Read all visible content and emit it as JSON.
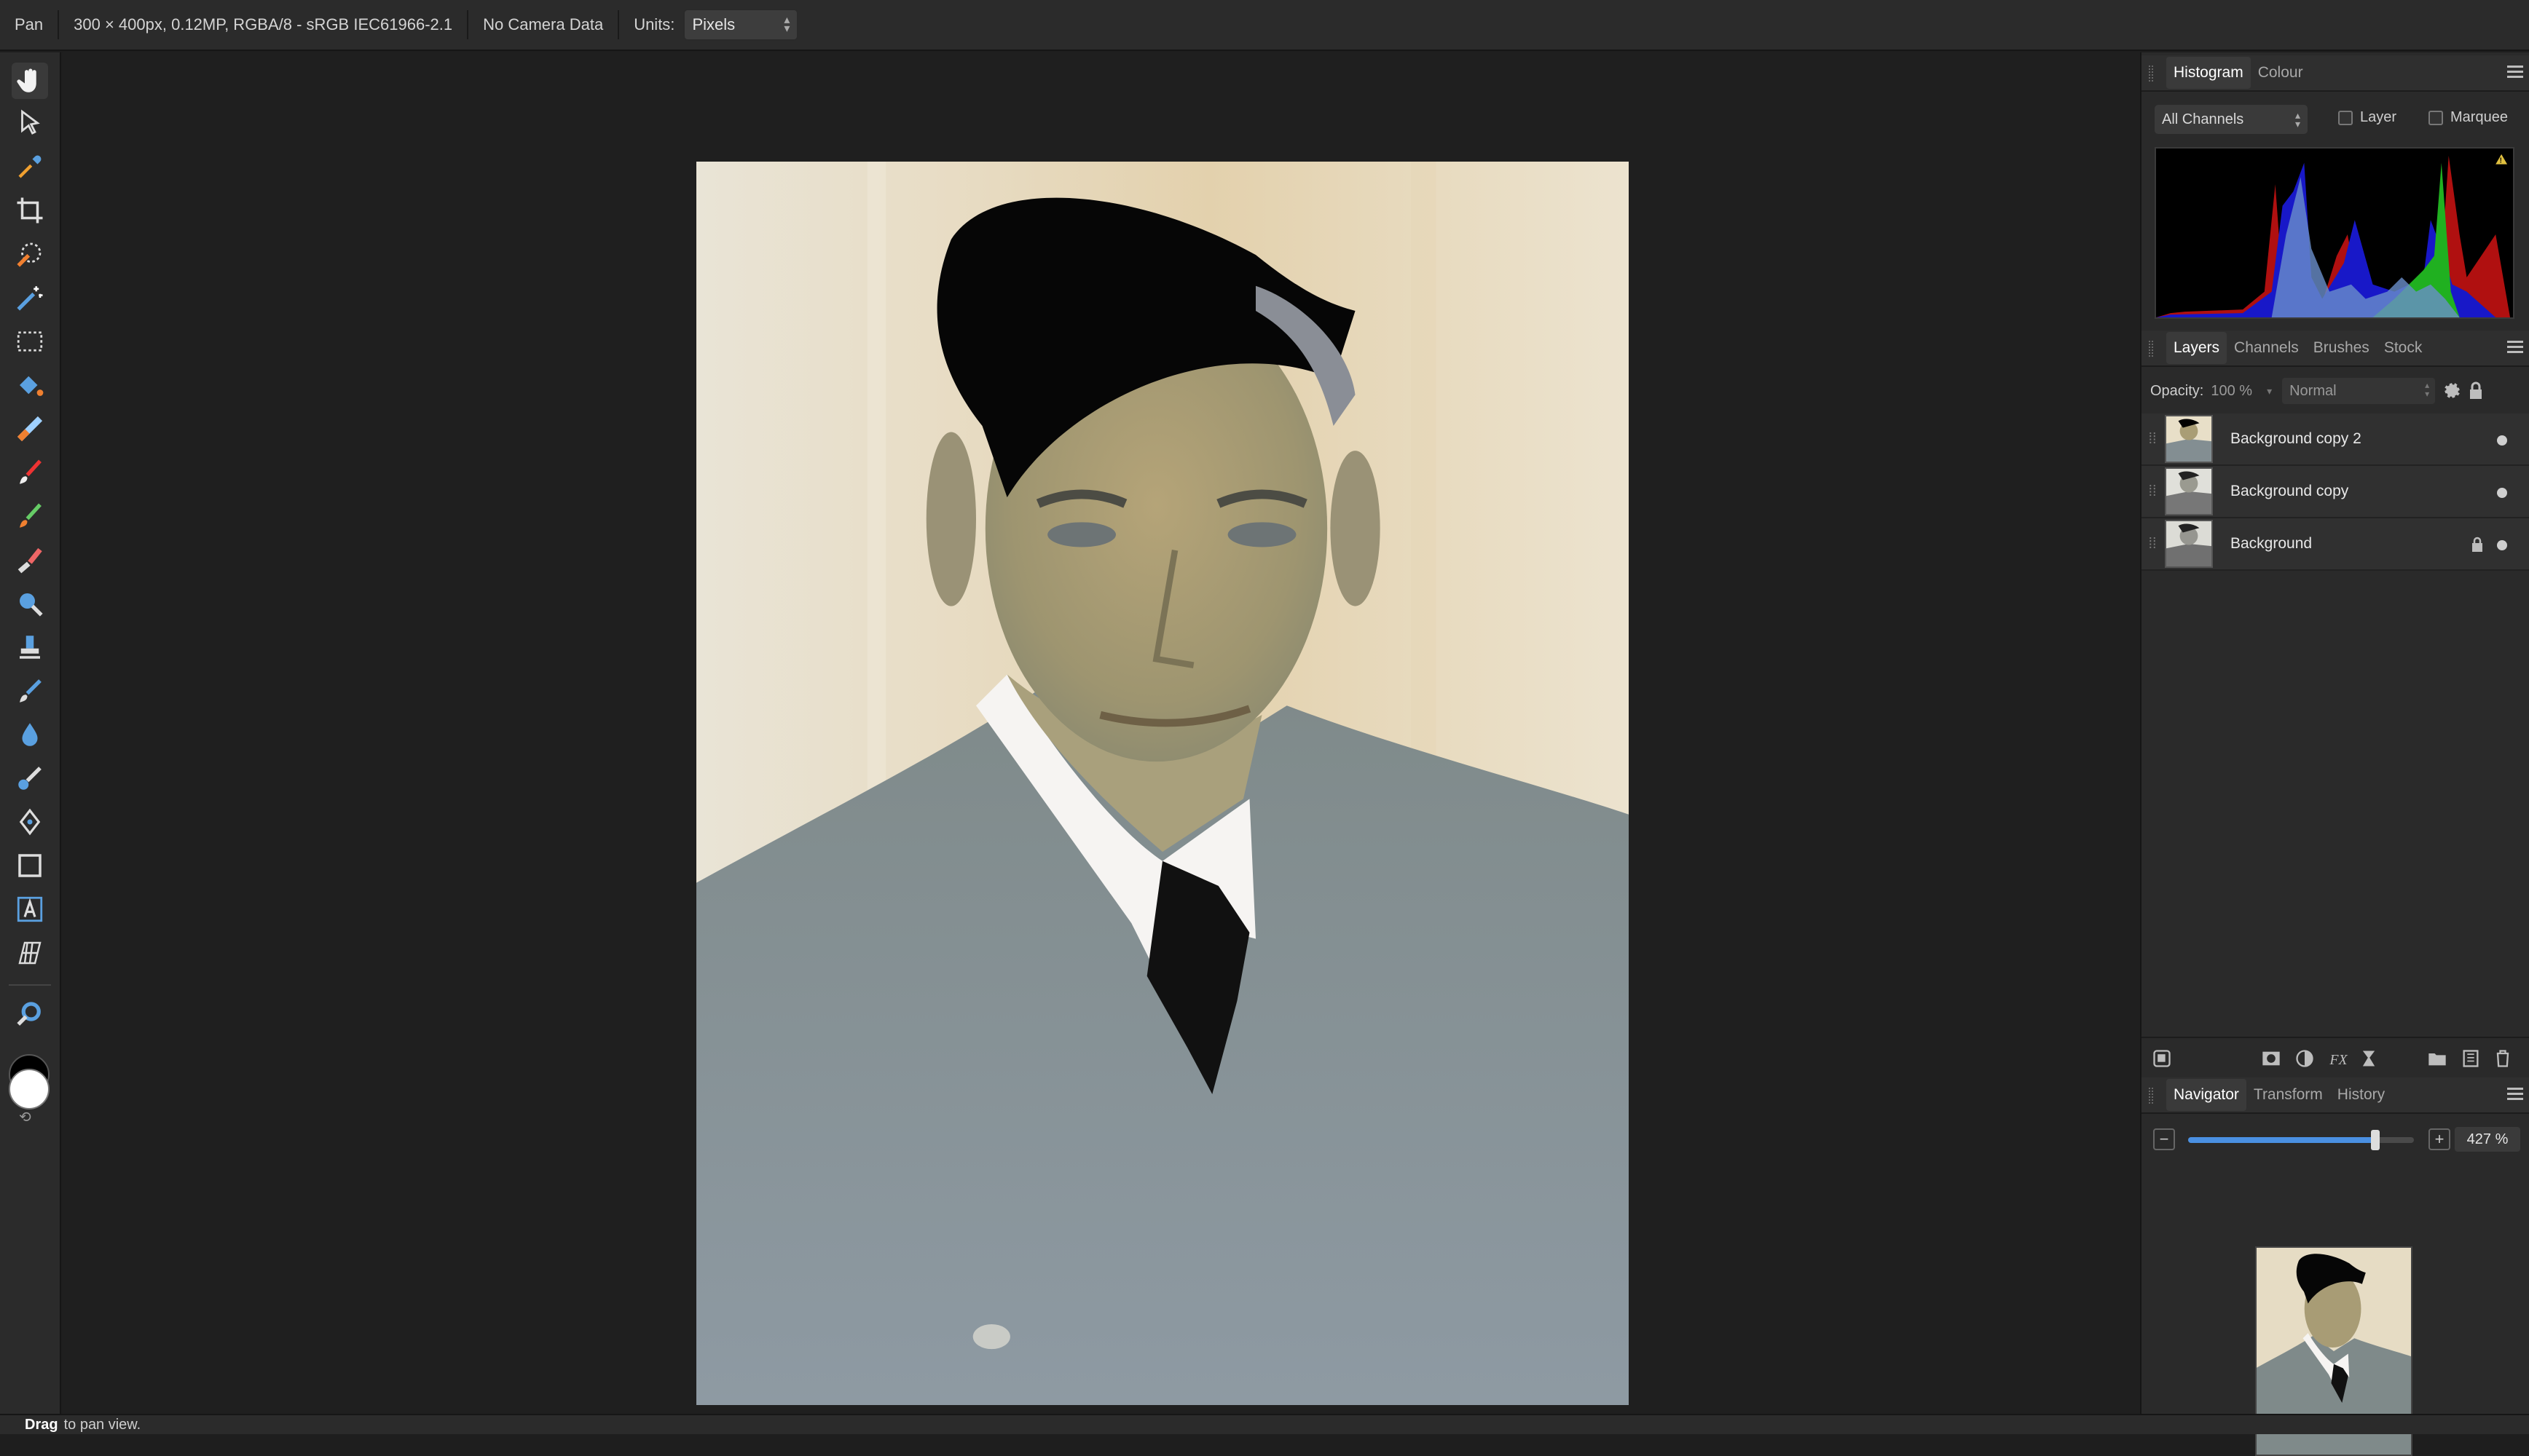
{
  "context_bar": {
    "tool_name": "Pan",
    "doc_info": "300 × 400px, 0.12MP, RGBA/8 - sRGB IEC61966-2.1",
    "camera": "No Camera Data",
    "units_label": "Units:",
    "units_value": "Pixels"
  },
  "tools": [
    "hand-icon",
    "move-icon",
    "color-picker-icon",
    "crop-icon",
    "selection-brush-icon",
    "magic-wand-icon",
    "marquee-icon",
    "flood-fill-icon",
    "gradient-icon",
    "paint-brush-icon",
    "color-replacement-icon",
    "erase-icon",
    "dodge-icon",
    "clone-icon",
    "smudge-icon",
    "blur-icon",
    "healing-icon",
    "pen-icon",
    "rectangle-icon",
    "artistic-text-icon",
    "mesh-warp-icon",
    "zoom-icon"
  ],
  "histogram_panel": {
    "tabs": [
      "Histogram",
      "Colour"
    ],
    "active_tab": "Histogram",
    "channel_select": "All Channels",
    "layer_checkbox": "Layer",
    "marquee_checkbox": "Marquee"
  },
  "layers_panel": {
    "tabs": [
      "Layers",
      "Channels",
      "Brushes",
      "Stock"
    ],
    "active_tab": "Layers",
    "opacity_label": "Opacity:",
    "opacity_value": "100 %",
    "blend_mode": "Normal",
    "layers": [
      {
        "name": "Background copy 2",
        "locked": false,
        "visible": true
      },
      {
        "name": "Background copy",
        "locked": false,
        "visible": true
      },
      {
        "name": "Background",
        "locked": true,
        "visible": true
      }
    ]
  },
  "navigator_panel": {
    "tabs": [
      "Navigator",
      "Transform",
      "History"
    ],
    "active_tab": "Navigator",
    "zoom_value": "427 %",
    "zoom_level_fraction": 0.83
  },
  "status_bar": {
    "action": "Drag",
    "hint": "to pan view."
  },
  "colors": {
    "primary": "#000000",
    "secondary": "#ffffff",
    "accent": "#4a90e2"
  }
}
